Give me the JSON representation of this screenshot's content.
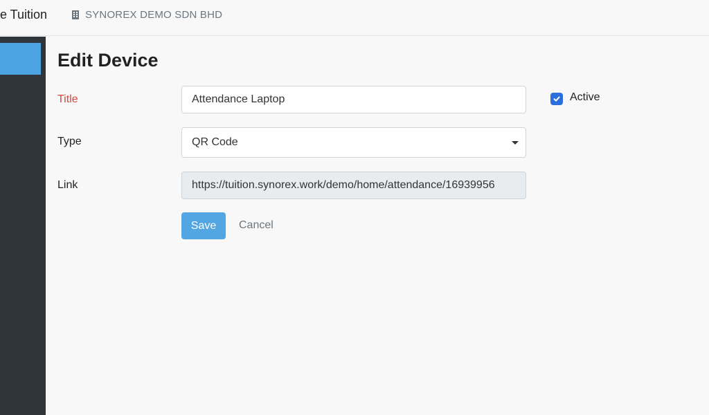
{
  "header": {
    "app_name": "e Tuition",
    "company_icon": "building-icon",
    "company_name": "SYNOREX DEMO SDN BHD"
  },
  "sidebar": {
    "active_color": "#4da3e2",
    "background_color": "#2f353a"
  },
  "page": {
    "title": "Edit Device"
  },
  "form": {
    "title_label": "Title",
    "title_value": "Attendance Laptop",
    "active_label": "Active",
    "active_checked": true,
    "type_label": "Type",
    "type_value": "QR Code",
    "link_label": "Link",
    "link_value": "https://tuition.synorex.work/demo/home/attendance/16939956",
    "save_label": "Save",
    "cancel_label": "Cancel"
  },
  "colors": {
    "accent": "#52a7e3",
    "required_label": "#d9463d",
    "checkbox": "#2a6fdb"
  }
}
